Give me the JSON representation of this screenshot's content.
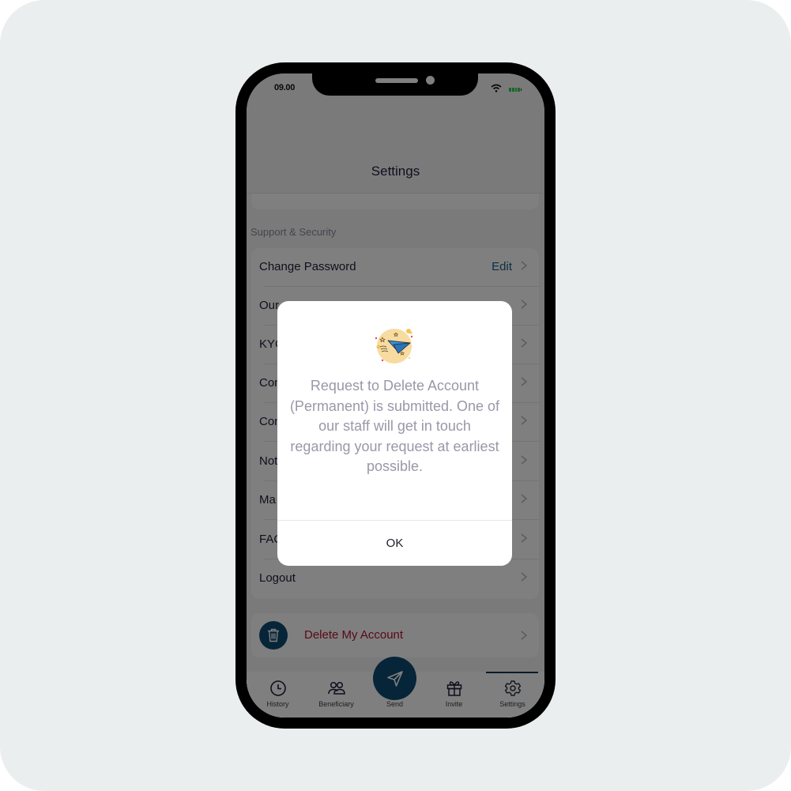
{
  "status_bar": {
    "time": "09.00"
  },
  "header": {
    "title": "Settings"
  },
  "support_section": {
    "label": "Support & Security",
    "items": [
      {
        "label": "Change Password",
        "action": "Edit"
      },
      {
        "label": "Our"
      },
      {
        "label": "KYC"
      },
      {
        "label": "Con"
      },
      {
        "label": "Con"
      },
      {
        "label": "Not"
      },
      {
        "label": "Ma"
      },
      {
        "label": "FAC"
      },
      {
        "label": "Logout"
      }
    ]
  },
  "delete_account": {
    "label": "Delete My Account",
    "icon": "trash-icon",
    "color": "#b4122e"
  },
  "tab_bar": {
    "active": "Settings",
    "tabs": [
      {
        "label": "History",
        "icon": "clock-icon"
      },
      {
        "label": "Beneficiary",
        "icon": "users-icon"
      },
      {
        "label": "Send",
        "icon": "paper-plane-icon"
      },
      {
        "label": "Invite",
        "icon": "gift-icon"
      },
      {
        "label": "Settings",
        "icon": "gear-icon"
      }
    ]
  },
  "dialog": {
    "illustration": "paper-plane-illustration",
    "message": "Request to Delete Account (Permanent) is submitted. One of our staff will get in touch regarding your request at earliest possible.",
    "ok_label": "OK"
  },
  "colors": {
    "brand": "#0e4a72",
    "danger": "#b4122e",
    "edit_link": "#1d5c86",
    "battery": "#2ecc55"
  }
}
